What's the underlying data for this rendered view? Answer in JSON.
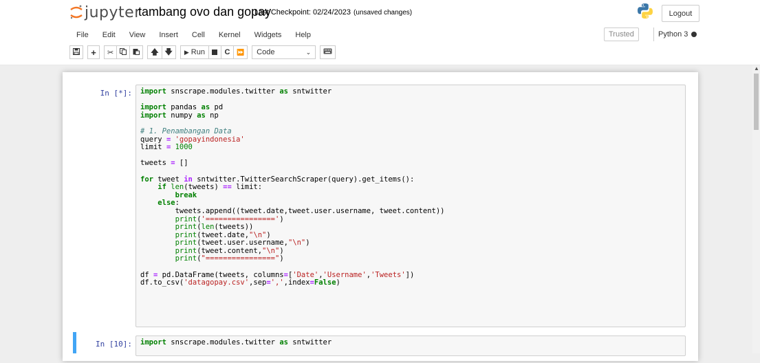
{
  "header": {
    "logo_text": "jupyter",
    "notebook_name": "tambang ovo dan gopay",
    "checkpoint": "Last Checkpoint: 02/24/2023",
    "unsaved": "(unsaved changes)",
    "logout_label": "Logout"
  },
  "menubar": {
    "items": [
      "File",
      "Edit",
      "View",
      "Insert",
      "Cell",
      "Kernel",
      "Widgets",
      "Help"
    ],
    "trusted_label": "Trusted",
    "kernel_name": "Python 3"
  },
  "toolbar": {
    "save_icon": "save-icon",
    "add_icon": "plus-icon",
    "cut_icon": "scissors-icon",
    "copy_icon": "copy-icon",
    "paste_icon": "paste-icon",
    "up_icon": "arrow-up-icon",
    "down_icon": "arrow-down-icon",
    "run_label": "Run",
    "stop_icon": "stop-icon",
    "restart_icon": "restart-icon",
    "fast_forward_icon": "fast-forward-icon",
    "cell_type": "Code",
    "keyboard_icon": "keyboard-icon"
  },
  "cells": [
    {
      "prompt": "In [*]:"
    },
    {
      "prompt": "In [10]:"
    }
  ],
  "colors": {
    "prompt": "#303f9f",
    "selected_cell": "#42a5f5",
    "keyword": "#008000",
    "string": "#ba2121"
  }
}
